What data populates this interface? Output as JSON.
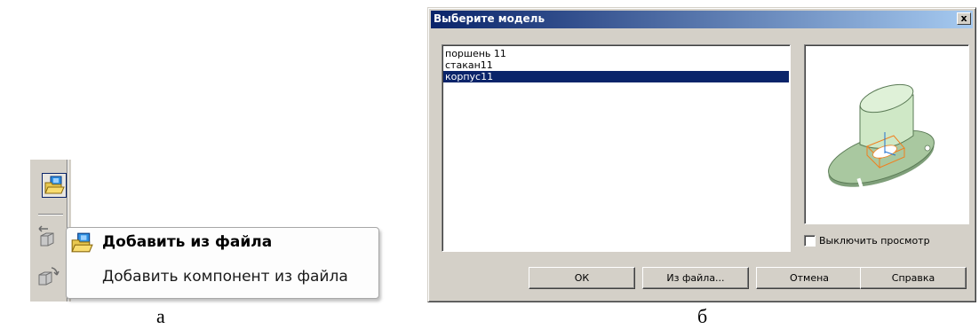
{
  "panel_a": {
    "tooltip": {
      "title": "Добавить из файла",
      "description": "Добавить компонент из файла"
    },
    "caption": "а"
  },
  "dialog": {
    "title": "Выберите модель",
    "close_label": "x",
    "models": [
      {
        "name": "поршень 11",
        "selected": false
      },
      {
        "name": "стакан11",
        "selected": false
      },
      {
        "name": "корпус11",
        "selected": true
      }
    ],
    "disable_preview_label": "Выключить просмотр",
    "disable_preview_checked": false,
    "buttons": {
      "ok": "ОК",
      "from_file": "Из файла...",
      "cancel": "Отмена",
      "help": "Справка"
    },
    "caption": "б"
  },
  "colors": {
    "selection": "#0a246a",
    "window_face": "#d4d0c8",
    "model_body": "#c8e6c0",
    "wireframe": "#f08020"
  }
}
